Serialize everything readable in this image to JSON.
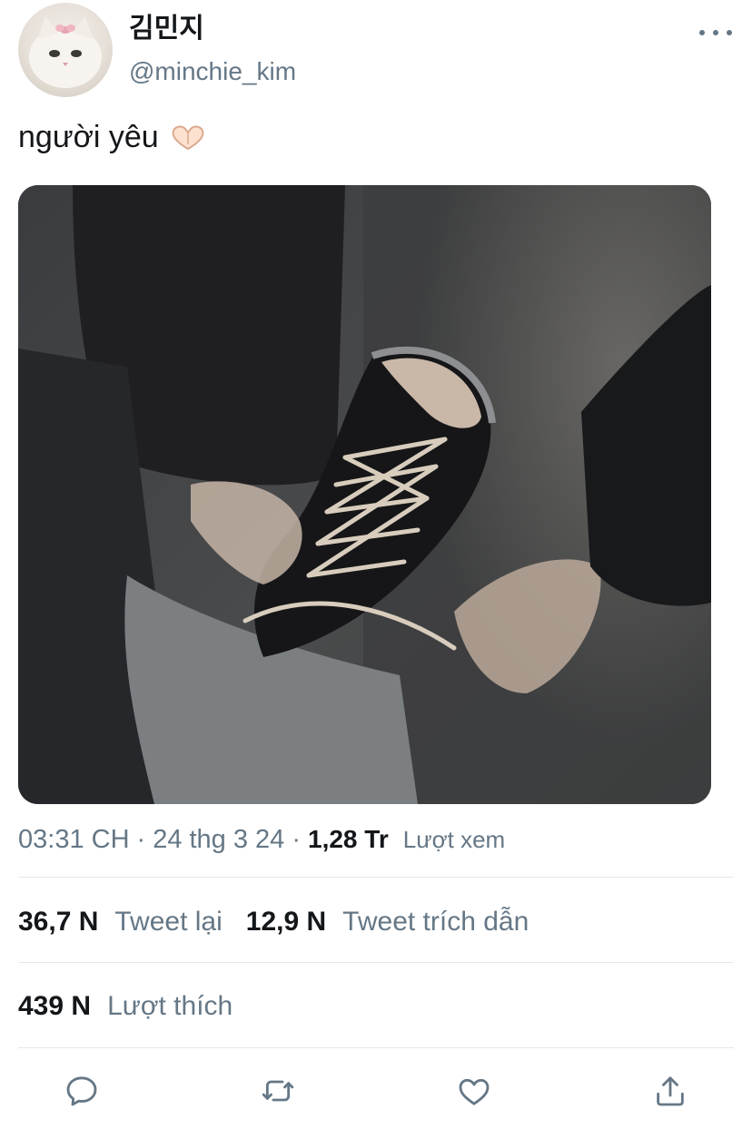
{
  "user": {
    "display_name": "김민지",
    "handle": "@minchie_kim"
  },
  "tweet": {
    "text": "người yêu",
    "emoji": "🫶🏻"
  },
  "meta": {
    "time": "03:31 CH",
    "date": "24 thg 3 24",
    "views_count": "1,28 Tr",
    "views_label": "Lượt xem"
  },
  "stats": {
    "retweets_count": "36,7 N",
    "retweets_label": "Tweet lại",
    "quotes_count": "12,9 N",
    "quotes_label": "Tweet trích dẫn",
    "likes_count": "439 N",
    "likes_label": "Lượt thích"
  },
  "icons": {
    "more": "more-horizontal-icon",
    "reply": "reply-icon",
    "retweet": "retweet-icon",
    "like": "heart-icon",
    "share": "share-icon"
  },
  "colors": {
    "text": "#14171a",
    "secondary": "#657786",
    "divider": "#e1e8ed"
  }
}
